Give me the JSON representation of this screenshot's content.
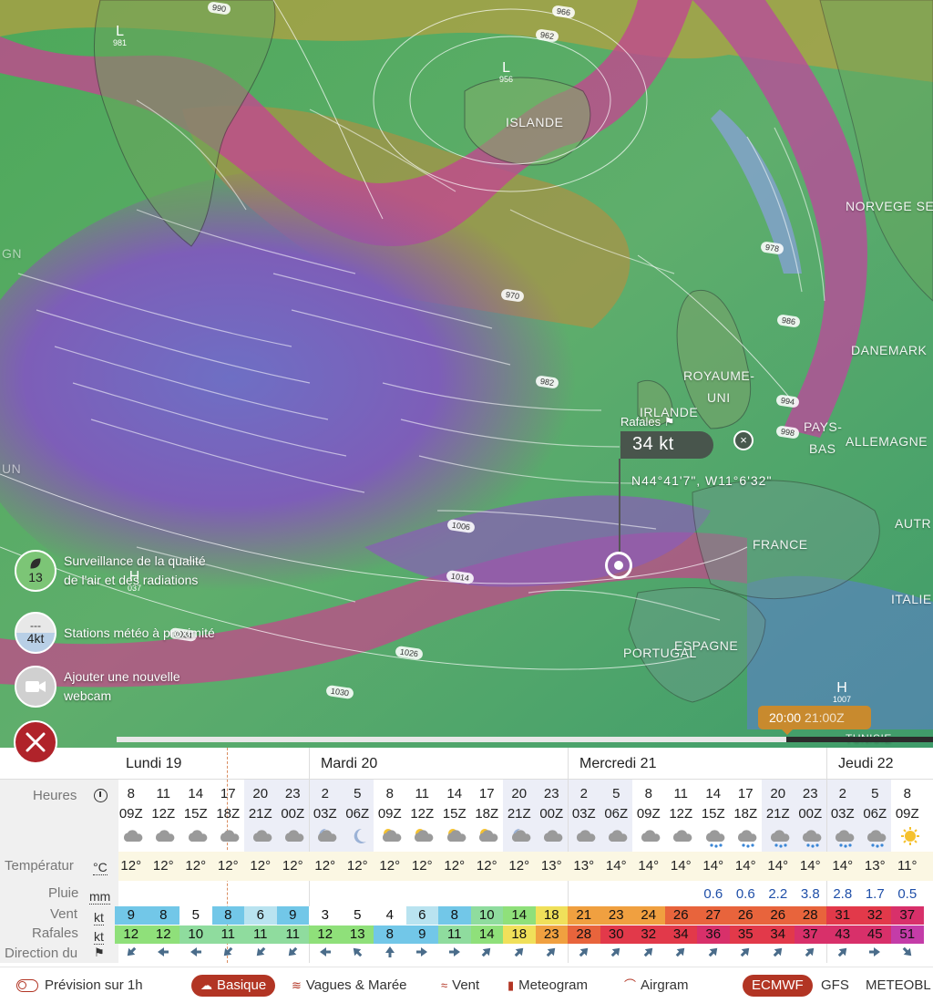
{
  "map": {
    "labels": [
      {
        "text": "ISLANDE"
      },
      {
        "text": "NORVEGE SE"
      },
      {
        "text": "DANEMARK"
      },
      {
        "text": "ROYAUME-"
      },
      {
        "text": "UNI"
      },
      {
        "text": "IRLANDE"
      },
      {
        "text": "PAYS-"
      },
      {
        "text": "BAS"
      },
      {
        "text": "ALLEMAGNE"
      },
      {
        "text": "FRANCE"
      },
      {
        "text": "AUTR"
      },
      {
        "text": "ITALIE"
      },
      {
        "text": "ESPAGNE"
      },
      {
        "text": "PORTUGAL"
      },
      {
        "text": "TUNISIE"
      },
      {
        "text": "GN"
      },
      {
        "text": "UN"
      }
    ],
    "isobars": [
      "990",
      "966",
      "962",
      "978",
      "970",
      "986",
      "982",
      "994",
      "998",
      "1006",
      "1014",
      "1026",
      "1034",
      "1030"
    ],
    "lows": [
      {
        "letter": "L",
        "value": "981"
      },
      {
        "letter": "L",
        "value": "956"
      }
    ],
    "highs": [
      {
        "letter": "H",
        "value": "037"
      },
      {
        "letter": "H",
        "value": "1007"
      }
    ]
  },
  "popup": {
    "title": "Rafales",
    "value": "34 kt",
    "coords": "N44°41'7\", W11°6'32\"",
    "close_icon": "×"
  },
  "widgets": {
    "air_quality": {
      "value": "13",
      "label": "Surveillance de la qualité de l'air et des radiations",
      "color": "#7cc576"
    },
    "stations": {
      "top": "---",
      "value": "4kt",
      "label": "Stations météo à proximité"
    },
    "webcam": {
      "label": "Ajouter une nouvelle webcam"
    }
  },
  "timeline": {
    "local": "20:00",
    "utc": "21:00Z",
    "progress": 0.82
  },
  "forecast": {
    "days": [
      "Lundi 19",
      "Mardi 20",
      "Mercredi 21",
      "Jeudi 22"
    ],
    "labels": {
      "hours": "Heures",
      "temperature": "Températur",
      "temp_unit": "°C",
      "rain": "Pluie",
      "rain_unit": "mm",
      "wind": "Vent",
      "wind_unit": "kt",
      "gusts": "Rafales",
      "gusts_unit": "kt",
      "direction": "Direction du"
    },
    "hours": [
      "8",
      "11",
      "14",
      "17",
      "20",
      "23",
      "2",
      "5",
      "8",
      "11",
      "14",
      "17",
      "20",
      "23",
      "2",
      "5",
      "8",
      "11",
      "14",
      "17",
      "20",
      "23",
      "2",
      "5",
      "8"
    ],
    "zulu": [
      "09Z",
      "12Z",
      "15Z",
      "18Z",
      "21Z",
      "00Z",
      "03Z",
      "06Z",
      "09Z",
      "12Z",
      "15Z",
      "18Z",
      "21Z",
      "00Z",
      "03Z",
      "06Z",
      "09Z",
      "12Z",
      "15Z",
      "18Z",
      "21Z",
      "00Z",
      "03Z",
      "06Z",
      "09Z"
    ],
    "night": [
      false,
      false,
      false,
      false,
      true,
      true,
      true,
      true,
      false,
      false,
      false,
      false,
      true,
      true,
      true,
      true,
      false,
      false,
      false,
      false,
      true,
      true,
      true,
      true,
      false
    ],
    "weather_icons": [
      "cloud",
      "cloud",
      "cloud",
      "cloud",
      "cloud",
      "cloud",
      "moon-cloud",
      "moon",
      "sun-cloud",
      "sun-cloud",
      "sun-cloud",
      "sun-cloud",
      "moon-cloud",
      "cloud",
      "cloud",
      "cloud",
      "cloud",
      "cloud",
      "rain",
      "rain",
      "rain",
      "rain",
      "rain",
      "rain",
      "sun"
    ],
    "temperature": [
      "12°",
      "12°",
      "12°",
      "12°",
      "12°",
      "12°",
      "12°",
      "12°",
      "12°",
      "12°",
      "12°",
      "12°",
      "12°",
      "13°",
      "13°",
      "14°",
      "14°",
      "14°",
      "14°",
      "14°",
      "14°",
      "14°",
      "14°",
      "13°",
      "11°"
    ],
    "rain": [
      "",
      "",
      "",
      "",
      "",
      "",
      "",
      "",
      "",
      "",
      "",
      "",
      "",
      "",
      "",
      "",
      "",
      "",
      "0.6",
      "0.6",
      "2.2",
      "3.8",
      "2.8",
      "1.7",
      "0.5"
    ],
    "wind": [
      9,
      8,
      5,
      8,
      6,
      9,
      3,
      5,
      4,
      6,
      8,
      10,
      14,
      18,
      21,
      23,
      24,
      26,
      27,
      26,
      26,
      28,
      31,
      32,
      37
    ],
    "gusts": [
      12,
      12,
      10,
      11,
      11,
      11,
      12,
      13,
      8,
      9,
      11,
      14,
      18,
      23,
      28,
      30,
      32,
      34,
      36,
      35,
      34,
      37,
      43,
      45,
      51
    ],
    "direction_deg": [
      225,
      270,
      270,
      225,
      225,
      225,
      270,
      315,
      0,
      90,
      90,
      45,
      45,
      45,
      45,
      45,
      45,
      45,
      45,
      45,
      45,
      45,
      45,
      90,
      135
    ]
  },
  "toolbar": {
    "forecast_1h": "Prévision sur 1h",
    "basic": "Basique",
    "waves": "Vagues & Marée",
    "wind": "Vent",
    "meteogram": "Meteogram",
    "airgram": "Airgram",
    "ecmwf": "ECMWF",
    "gfs": "GFS",
    "meteoblue": "METEOBL"
  }
}
